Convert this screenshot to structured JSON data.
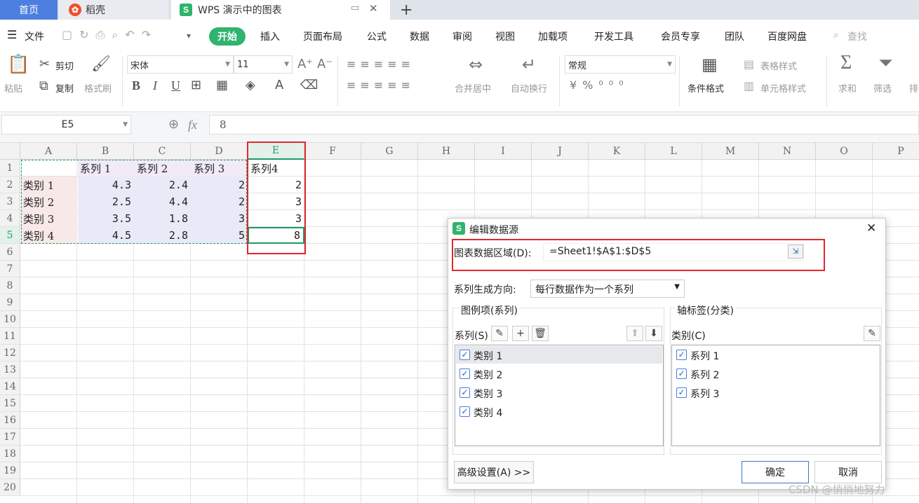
{
  "tabs": {
    "home": "首页",
    "docer": "稻壳",
    "doc": "WPS 演示中的图表",
    "new_tab": "+"
  },
  "menu": {
    "file": "文件",
    "items": [
      "开始",
      "插入",
      "页面布局",
      "公式",
      "数据",
      "审阅",
      "视图",
      "加载项",
      "开发工具",
      "会员专享",
      "团队",
      "百度网盘"
    ],
    "search": "查找"
  },
  "ribbon": {
    "paste": "粘贴",
    "cut": "剪切",
    "copy": "复制",
    "format_painter": "格式刷",
    "font_name": "宋体",
    "font_size": "11",
    "merge_center": "合并居中",
    "wrap": "自动换行",
    "number_format": "常规",
    "conditional": "条件格式",
    "table_style": "表格样式",
    "cell_style": "单元格样式",
    "sum": "求和",
    "filter": "筛选",
    "sort": "排"
  },
  "formula_bar": {
    "name_box": "E5",
    "fx": "fx",
    "value": "8"
  },
  "columns": [
    "A",
    "B",
    "C",
    "D",
    "E",
    "F",
    "G",
    "H",
    "I",
    "J",
    "K",
    "L",
    "M",
    "N",
    "O",
    "P"
  ],
  "rows": [
    "1",
    "2",
    "3",
    "4",
    "5",
    "6",
    "7",
    "8",
    "9",
    "10",
    "11",
    "12",
    "13",
    "14",
    "15",
    "16",
    "17",
    "18",
    "19",
    "20"
  ],
  "sheet": {
    "header": [
      "",
      "系列 1",
      "系列 2",
      "系列 3",
      "系列4"
    ],
    "data": [
      [
        "类别 1",
        "4.3",
        "2.4",
        "2",
        "2"
      ],
      [
        "类别 2",
        "2.5",
        "4.4",
        "2",
        "3"
      ],
      [
        "类别 3",
        "3.5",
        "1.8",
        "3",
        "3"
      ],
      [
        "类别 4",
        "4.5",
        "2.8",
        "5",
        "8"
      ]
    ]
  },
  "dialog": {
    "title": "编辑数据源",
    "close": "✕",
    "range_label": "图表数据区域(D):",
    "range_value": "=Sheet1!$A$1:$D$5",
    "direction_label": "系列生成方向:",
    "direction_value": "每行数据作为一个系列",
    "legend_title": "图例项(系列)",
    "axis_title": "轴标签(分类)",
    "series_label": "系列(S)",
    "category_label": "类别(C)",
    "legend_items": [
      "类别 1",
      "类别 2",
      "类别 3",
      "类别 4"
    ],
    "axis_items": [
      "系列 1",
      "系列 2",
      "系列 3"
    ],
    "advanced": "高级设置(A) >>",
    "ok": "确定",
    "cancel": "取消"
  },
  "watermark": "CSDN @悄悄地努力",
  "colors": {
    "accent_green": "#2fb36d",
    "tab_blue": "#4c7fe0",
    "highlight_red": "#e0282e"
  }
}
